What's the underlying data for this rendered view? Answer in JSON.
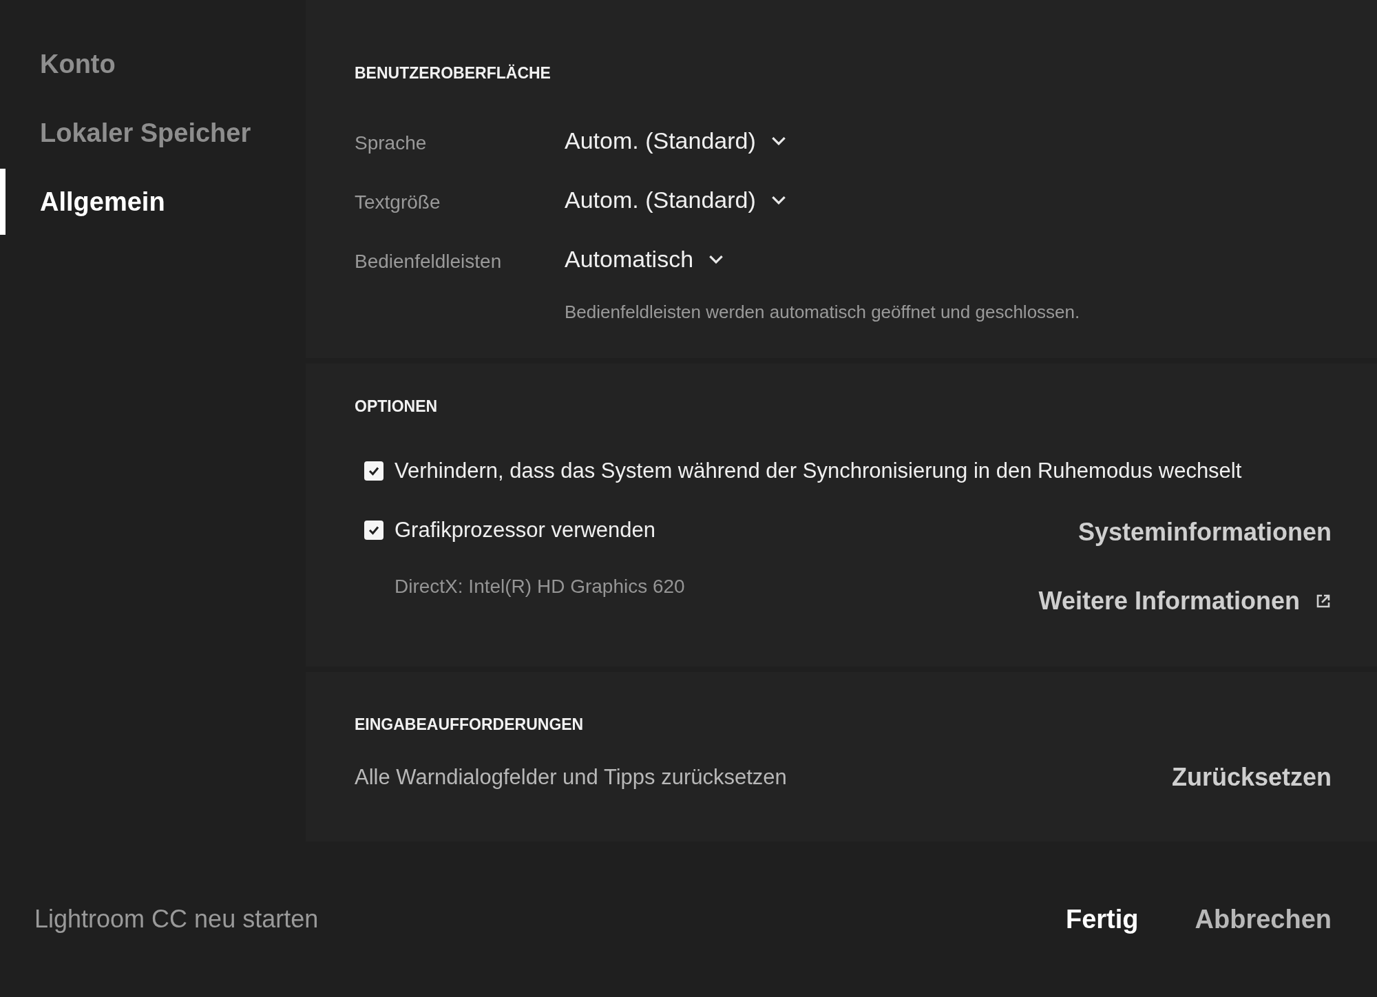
{
  "sidebar": {
    "items": [
      {
        "label": "Konto",
        "selected": false
      },
      {
        "label": "Lokaler Speicher",
        "selected": false
      },
      {
        "label": "Allgemein",
        "selected": true
      }
    ]
  },
  "interface": {
    "heading": "BENUTZEROBERFLÄCHE",
    "rows": [
      {
        "label": "Sprache",
        "value": "Autom. (Standard)"
      },
      {
        "label": "Textgröße",
        "value": "Autom. (Standard)"
      },
      {
        "label": "Bedienfeldleisten",
        "value": "Automatisch"
      }
    ],
    "hint": "Bedienfeldleisten werden automatisch geöffnet und geschlossen."
  },
  "options": {
    "heading": "OPTIONEN",
    "checkboxes": [
      {
        "label": "Verhindern, dass das System während der Synchronisierung in den Ruhemodus wechselt",
        "checked": true
      },
      {
        "label": "Grafikprozessor verwenden",
        "checked": true
      }
    ],
    "gpu_info": "DirectX: Intel(R) HD Graphics 620",
    "system_info_link": "Systeminformationen",
    "more_info_link": "Weitere Informationen"
  },
  "prompts": {
    "heading": "EINGABEAUFFORDERUNGEN",
    "text": "Alle Warndialogfelder und Tipps zurücksetzen",
    "button": "Zurücksetzen"
  },
  "footer": {
    "restart": "Lightroom CC neu starten",
    "buttons": [
      {
        "label": "Fertig",
        "primary": true
      },
      {
        "label": "Abbrechen",
        "primary": false
      }
    ]
  }
}
